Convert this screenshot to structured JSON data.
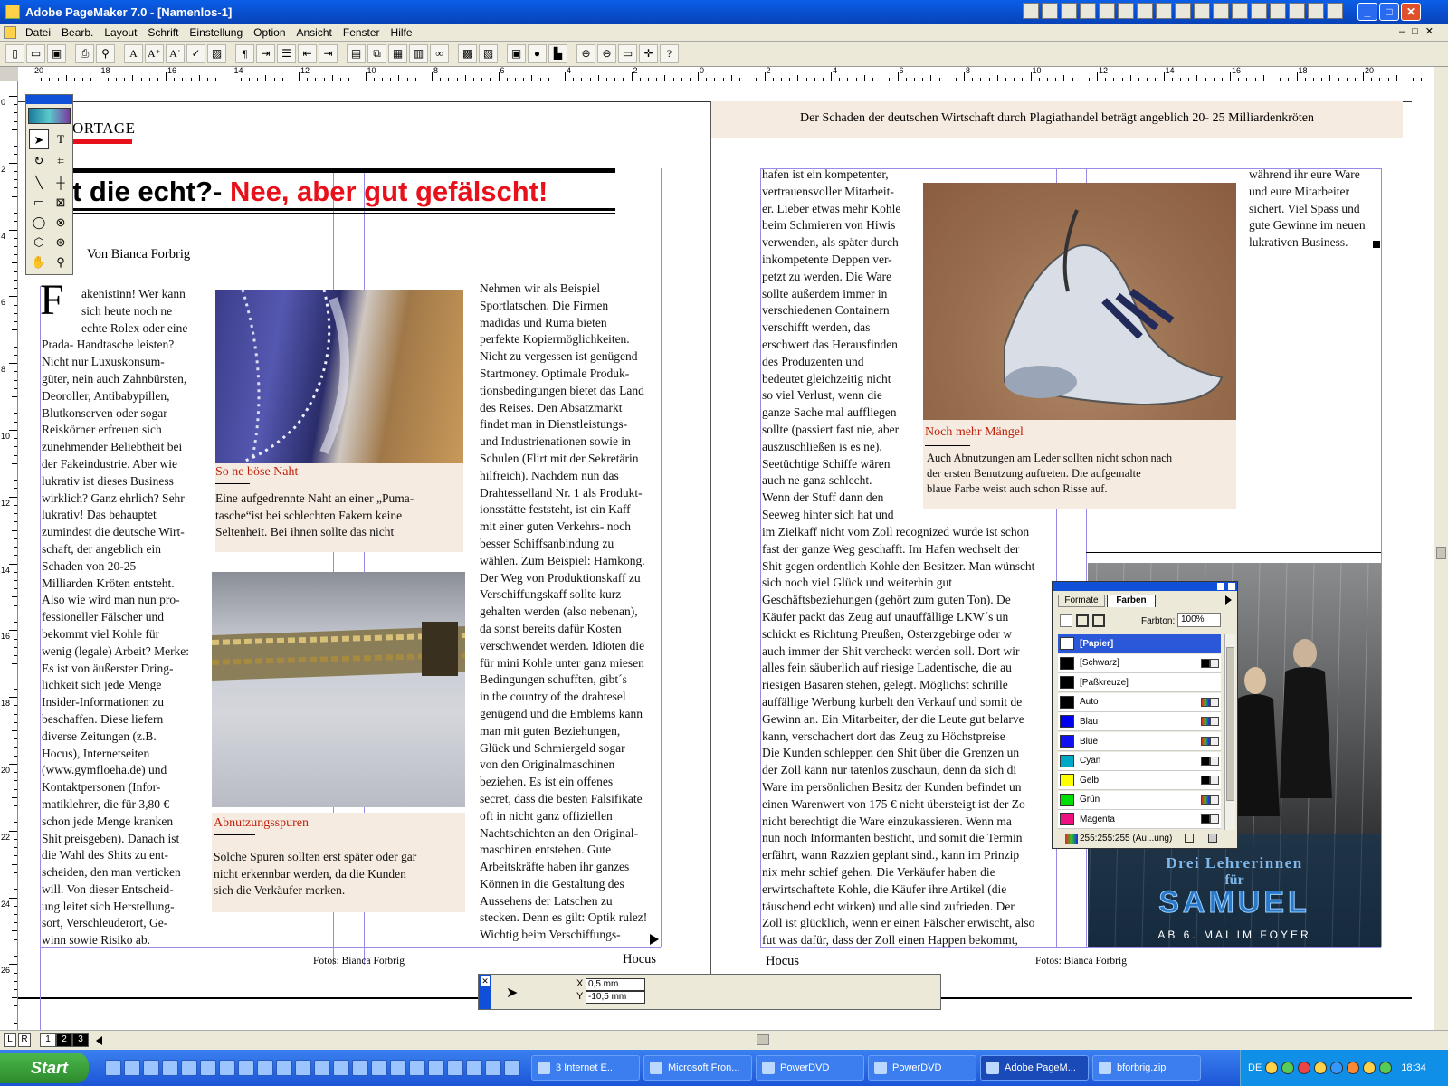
{
  "window": {
    "title": "Adobe PageMaker 7.0 - [Namenlos-1]"
  },
  "menu": [
    "Datei",
    "Bearb.",
    "Layout",
    "Schrift",
    "Einstellung",
    "Option",
    "Ansicht",
    "Fenster",
    "Hilfe"
  ],
  "ruler_h_labels": [
    "20",
    "18",
    "16",
    "14",
    "12",
    "10",
    "8",
    "6",
    "4",
    "2",
    "0",
    "2",
    "4",
    "6",
    "8",
    "10",
    "12",
    "14",
    "16",
    "18",
    "20"
  ],
  "ruler_v_labels": [
    "0",
    "2",
    "4",
    "6",
    "8",
    "10",
    "12",
    "14",
    "16",
    "18",
    "20",
    "22",
    "24",
    "26"
  ],
  "left_page": {
    "section": "ORTAGE",
    "headline_black": "t die echt?- ",
    "headline_red": "Nee, aber gut gefälscht!",
    "byline": "Von Bianca Forbrig",
    "drop_cap": "F",
    "col1_lines": [
      "akenistinn! Wer kann",
      "sich heute noch ne",
      "echte Rolex oder eine",
      "Prada- Handtasche leisten?",
      "Nicht nur Luxuskonsum-",
      "güter, nein auch Zahnbürsten,",
      "Deoroller, Antibabypillen,",
      "Blutkonserven oder sogar",
      "Reiskörner erfreuen sich",
      "zunehmender Beliebtheit bei",
      "der Fakeindustrie. Aber wie",
      "lukrativ ist dieses Business",
      "wirklich? Ganz ehrlich? Sehr",
      "lukrativ! Das behauptet",
      "zumindest die deutsche Wirt-",
      "schaft, der angeblich ein",
      "Schaden von 20-25",
      "Milliarden Kröten entsteht.",
      "Also wie wird man nun pro-",
      "fessioneller Fälscher und",
      "bekommt viel Kohle für",
      "wenig (legale) Arbeit? Merke:",
      "Es ist von äußerster Dring-",
      "lichkeit sich jede Menge",
      "Insider-Informationen zu",
      "beschaffen. Diese liefern",
      "diverse Zeitungen (z.B.",
      "Hocus), Internetseiten",
      "(www.gymfloeha.de) und",
      "Kontaktpersonen (Infor-",
      "matiklehrer, die für 3,80 €",
      "schon jede Menge kranken",
      "Shit preisgeben). Danach ist",
      "die Wahl des Shits zu ent-",
      "scheiden, den man verticken",
      "will. Von dieser Entscheid-",
      "ung leitet sich Herstellung-",
      "sort, Verschleuderort, Ge-",
      "winn sowie Risiko ab."
    ],
    "caption1_title": "So ne böse Naht",
    "caption1_text": [
      "Eine aufgedrennte Naht an einer „Puma-",
      "tasche“ist bei schlechten Fakern keine",
      "Seltenheit. Bei ihnen sollte das nicht"
    ],
    "caption2_title": "Abnutzungsspuren",
    "caption2_text": [
      "Solche Spuren sollten erst später oder gar",
      "nicht erkennbar werden, da die Kunden",
      "sich die Verkäufer merken."
    ],
    "col3_lines": [
      "Nehmen wir als Beispiel",
      "Sportlatschen. Die Firmen",
      "madidas und Ruma bieten",
      "perfekte Kopiermöglichkeiten.",
      "Nicht zu vergessen ist genügend",
      "Startmoney. Optimale Produk-",
      "tionsbedingungen bietet das Land",
      "des Reises. Den Absatzmarkt",
      "findet man in Dienstleistungs-",
      "und Industrienationen sowie in",
      "Schulen (Flirt mit der Sekretärin",
      "hilfreich). Nachdem nun das",
      "Drahtesselland Nr. 1 als Produkt-",
      "ionsstätte feststeht, ist ein Kaff",
      "mit einer guten Verkehrs- noch",
      "besser Schiffsanbindung zu",
      "wählen. Zum Beispiel: Hamkong.",
      "Der Weg von Produktionskaff zu",
      "Verschiffungskaff sollte kurz",
      "gehalten werden (also nebenan),",
      "da sonst bereits dafür Kosten",
      "verschwendet werden. Idioten die",
      "für mini Kohle unter ganz miesen",
      "Bedingungen schufften, gibt´s",
      "in the country of the drahtesel",
      "genügend und die Emblems kann",
      "man mit guten Beziehungen,",
      "Glück und Schmiergeld sogar",
      "von den Originalmaschinen",
      "beziehen. Es ist ein offenes",
      "secret, dass die besten Falsifikate",
      "oft in nicht ganz offiziellen",
      "Nachtschichten an den Original-",
      "maschinen entstehen. Gute",
      "Arbeitskräfte haben ihr ganzes",
      "Können in die Gestaltung des",
      "Aussehens der Latschen zu",
      "stecken. Denn es gilt: Optik rulez!",
      "Wichtig beim Verschiffungs-"
    ],
    "footer_credit": "Fotos: Bianca Forbrig",
    "footer_name": "Hocus"
  },
  "right_page": {
    "header": "Der Schaden der deutschen Wirtschaft durch Plagiathandel beträgt angeblich 20- 25 Milliardenkröten",
    "col1_lines": [
      "hafen ist ein kompetenter,",
      "vertrauensvoller Mitarbeit-",
      "er. Lieber etwas mehr Kohle",
      "beim Schmieren von Hiwis",
      "verwenden, als später durch",
      "inkompetente Deppen ver-",
      "petzt zu werden. Die Ware",
      "sollte außerdem immer in",
      "verschiedenen Containern",
      "verschifft werden, das",
      "erschwert das Herausfinden",
      "des Produzenten und",
      "bedeutet gleichzeitig nicht",
      "so viel Verlust, wenn die",
      "ganze Sache mal auffliegen",
      "sollte (passiert fast nie, aber",
      "auszuschließen is es ne).",
      "Seetüchtige Schiffe wären",
      "auch ne ganz schlecht.",
      "Wenn der Stuff dann den",
      "Seeweg hinter sich hat und"
    ],
    "wide_lines": [
      "im Zielkaff nicht vom Zoll recognized wurde ist schon",
      "fast der ganze Weg geschafft. Im Hafen wechselt der",
      "Shit gegen ordentlich Kohle den Besitzer. Man wünscht",
      "sich noch viel Glück und weiterhin gut",
      "Geschäftsbeziehungen (gehört zum guten Ton). De",
      "Käufer packt das Zeug auf unauffällige LKW´s un",
      "schickt es Richtung Preußen, Osterzgebirge oder w",
      "auch immer der Shit vercheckt werden soll. Dort wir",
      "alles fein säuberlich auf riesige Ladentische, die au",
      "riesigen Basaren stehen, gelegt. Möglichst schrille",
      "auffällige Werbung kurbelt den Verkauf und somit de",
      "Gewinn an. Ein Mitarbeiter, der die Leute gut belarve",
      "kann, verschachert dort das Zeug zu Höchstpreise",
      "Die Kunden schleppen den Shit über die Grenzen un",
      "der Zoll kann nur tatenlos zuschaun, denn da sich di",
      "Ware im persönlichen Besitz der Kunden befindet un",
      "einen Warenwert von 175 € nicht übersteigt ist der Zo",
      "nicht berechtigt die Ware einzukassieren. Wenn ma",
      "nun noch Informanten besticht, und somit die Termin",
      "erfährt, wann Razzien geplant sind., kann im Prinzip",
      "nix mehr schief gehen. Die Verkäufer haben die",
      "erwirtschaftete Kohle, die Käufer ihre Artikel (die",
      "täuschend echt wirken) und alle sind zufrieden. Der",
      "Zoll ist glücklich, wenn er einen Fälscher erwischt, also",
      "fut was dafür, dass der Zoll einen Happen bekommt,"
    ],
    "col3_lines": [
      "während ihr eure Ware",
      "und eure Mitarbeiter",
      "sichert. Viel Spass und",
      "gute Gewinne im neuen",
      "lukrativen Business."
    ],
    "caption_title": "Noch mehr Mängel",
    "caption_text": [
      "Auch Abnutzungen am Leder sollten nicht schon nach",
      "der ersten Benutzung auftreten. Die aufgemalte",
      "blaue Farbe weist auch schon Risse auf."
    ],
    "poster_line1": "Drei Lehrerinnen",
    "poster_line2": "für",
    "poster_line3": "SAMUEL",
    "poster_line4": "ab 6. Mai im Foyer",
    "footer_name": "Hocus",
    "footer_credit": "Fotos: Bianca Forbrig"
  },
  "colors_panel": {
    "tab_formats": "Formate",
    "tab_colors": "Farben",
    "tint_label": "Farbton:",
    "tint_value": "100%",
    "items": [
      {
        "name": "[Papier]",
        "swatch": "#ffffff"
      },
      {
        "name": "[Schwarz]",
        "swatch": "#000000"
      },
      {
        "name": "[Paßkreuze]",
        "swatch": "#000000"
      },
      {
        "name": "Auto",
        "swatch": "#000000"
      },
      {
        "name": "Blau",
        "swatch": "#0000ee"
      },
      {
        "name": "Blue",
        "swatch": "#1010f0"
      },
      {
        "name": "Cyan",
        "swatch": "#00a8c8"
      },
      {
        "name": "Gelb",
        "swatch": "#ffff00"
      },
      {
        "name": "Grün",
        "swatch": "#00dd00"
      },
      {
        "name": "Magenta",
        "swatch": "#ee1080"
      }
    ],
    "footer_value": "255:255:255 (Au...ung)"
  },
  "coords": {
    "x_label": "X",
    "y_label": "Y",
    "x_value": "0,5 mm",
    "y_value": "-10,5 mm"
  },
  "pages": {
    "l": "L",
    "r": "R",
    "p1": "1",
    "p2": "2",
    "p3": "3"
  },
  "taskbar": {
    "start": "Start",
    "tasks": [
      "3 Internet E...",
      "Microsoft Fron...",
      "PowerDVD",
      "PowerDVD",
      "Adobe PageM...",
      "bforbrig.zip"
    ],
    "lang": "DE",
    "clock": "18:34"
  },
  "accent_colors": {
    "headline_red": "#e8101a",
    "caption_bg": "#f5ebe0",
    "guide": "#9a8ae8",
    "title_blue": "#0a5ee8"
  }
}
